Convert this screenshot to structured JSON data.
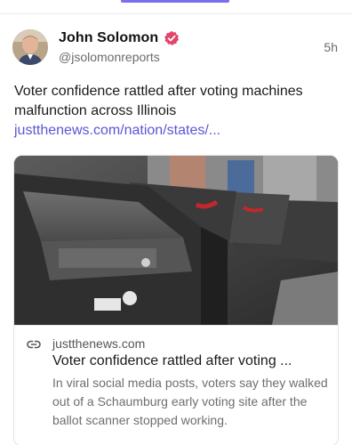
{
  "post": {
    "author_name": "John Solomon",
    "handle": "@jsolomonreports",
    "timestamp": "5h",
    "text": "Voter confidence rattled after voting machines malfunction across Illinois",
    "link_text": "justthenews.com/nation/states/...",
    "verified_icon": "verified-badge-icon",
    "accent_color": "#5b56d6",
    "badge_color": "#e0456a"
  },
  "card": {
    "domain": "justthenews.com",
    "title": "Voter confidence rattled after voting ...",
    "description": "In viral social media posts, voters say they walked out of a Schaumburg early voting site after the ballot scanner stopped working.",
    "link_icon": "link-icon"
  }
}
